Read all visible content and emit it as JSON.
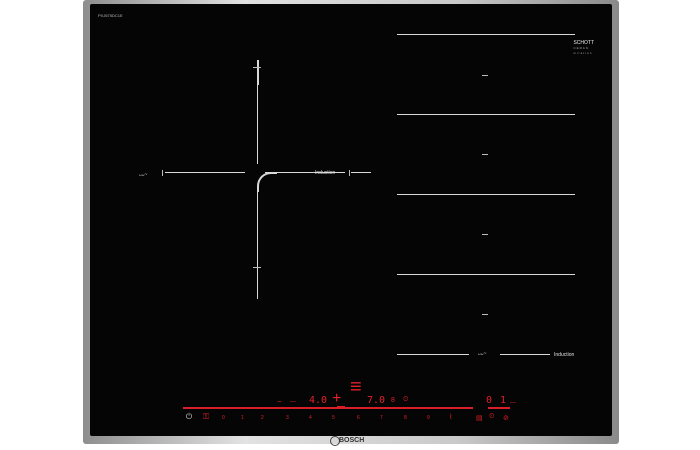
{
  "model": "PXJ675DC1E",
  "schott": {
    "line1": "SCHOTT",
    "line2": "CERAN",
    "line3": "miratron"
  },
  "labels": {
    "left_icon": "ᴗᴗ~",
    "center_induction": "Induction",
    "bottom_icon": "ᴗᴗ~",
    "bottom_induction": "Induction"
  },
  "display": {
    "left_value": "4.0",
    "mid_value": "7.0",
    "right_value": "0",
    "far_right_value": "1"
  },
  "scale_numbers": [
    "0",
    "1",
    "2",
    "3",
    "4",
    "5",
    "6",
    "7",
    "8",
    "9"
  ],
  "controls": {
    "power": "⏻",
    "lock": "⚿",
    "timer": "⏲",
    "plus": "+",
    "minus": "−",
    "flex": "≡"
  },
  "brand": "BOSCH"
}
